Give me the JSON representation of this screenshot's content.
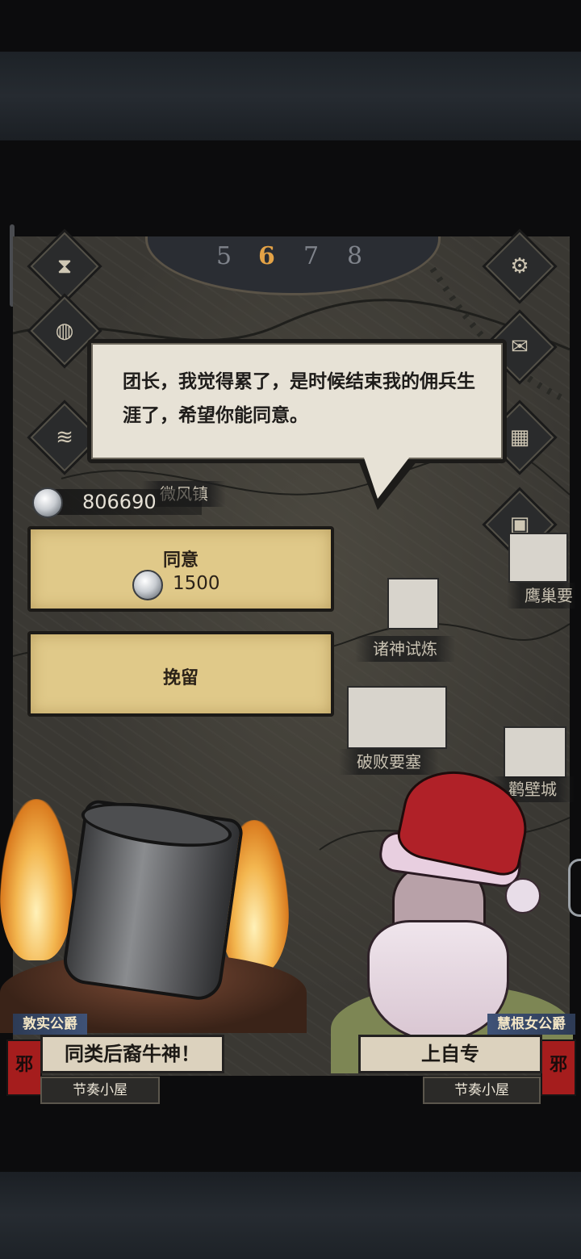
{
  "dialog": {
    "text": "团长，我觉得累了，是时候结束我的佣兵生涯了，希望你能同意。"
  },
  "currency": {
    "silver": "806690"
  },
  "choices": {
    "agree": {
      "label": "同意",
      "cost": "1500"
    },
    "retain": {
      "label": "挽留"
    }
  },
  "calendar": {
    "days": [
      "5",
      "6",
      "7",
      "8"
    ],
    "current": "6"
  },
  "map_labels": {
    "town": "微风镇",
    "trial": "诸神试炼",
    "fortress": "破败要塞",
    "city": "鹳壁城",
    "eagle": "鹰巢要"
  },
  "left_character": {
    "rank": "敦实公爵",
    "name": "同类后裔牛神！",
    "group": "节奏小屋",
    "banner_mark": "邪"
  },
  "right_character": {
    "rank": "慧根女公爵",
    "name": "上自专",
    "group": "节奏小屋",
    "banner_mark": "邪"
  }
}
